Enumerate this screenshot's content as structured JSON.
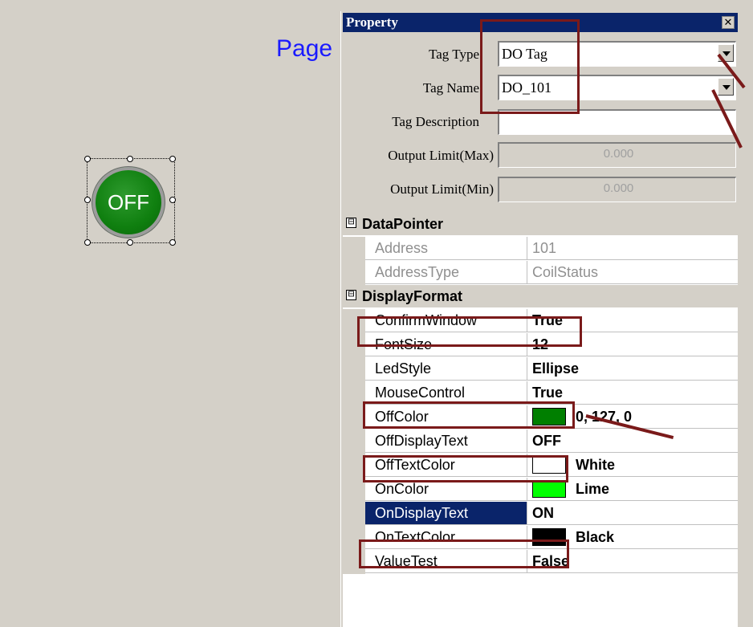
{
  "canvas": {
    "page_title": "Page",
    "led_button": {
      "text": "OFF",
      "color": "#0f7f0f"
    }
  },
  "panel": {
    "title": "Property",
    "close_symbol": "✕",
    "header_fields": [
      {
        "label": "Tag Type",
        "value": "DO Tag",
        "dropdown": true
      },
      {
        "label": "Tag Name",
        "value": "DO_101",
        "dropdown": true
      },
      {
        "label": "Tag Description",
        "value": ""
      },
      {
        "label": "Output Limit(Max)",
        "value": "0.000",
        "disabled": true
      },
      {
        "label": "Output Limit(Min)",
        "value": "0.000",
        "disabled": true
      }
    ],
    "categories": [
      {
        "name": "DataPointer",
        "toggle": "⊟",
        "rows": [
          {
            "name": "Address",
            "value": "101",
            "readonly": true
          },
          {
            "name": "AddressType",
            "value": "CoilStatus",
            "readonly": true
          }
        ]
      },
      {
        "name": "DisplayFormat",
        "toggle": "⊟",
        "rows": [
          {
            "name": "ConfirmWindow",
            "value": "True"
          },
          {
            "name": "FontSize",
            "value": "12"
          },
          {
            "name": "LedStyle",
            "value": "Ellipse"
          },
          {
            "name": "MouseControl",
            "value": "True"
          },
          {
            "name": "OffColor",
            "value": "0, 127, 0",
            "swatch": "#007f00"
          },
          {
            "name": "OffDisplayText",
            "value": "OFF"
          },
          {
            "name": "OffTextColor",
            "value": "White",
            "swatch": "#ffffff"
          },
          {
            "name": "OnColor",
            "value": "Lime",
            "swatch": "#00ff00"
          },
          {
            "name": "OnDisplayText",
            "value": "ON",
            "selected": true
          },
          {
            "name": "OnTextColor",
            "value": "Black",
            "swatch": "#000000"
          },
          {
            "name": "ValueTest",
            "value": "False"
          }
        ]
      }
    ]
  },
  "colors": {
    "highlight_annotation": "#7a1a1a",
    "title_bar": "#0a246a",
    "page_title_color": "#1a1aff"
  }
}
